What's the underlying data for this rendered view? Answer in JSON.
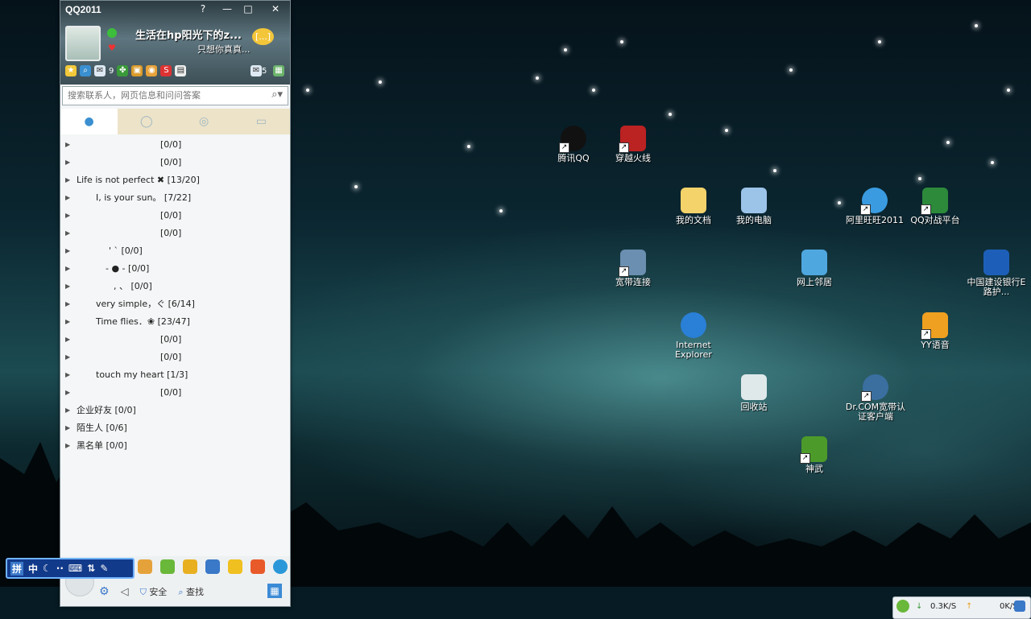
{
  "qq_window": {
    "title": "QQ2011",
    "nickname": "生活在hp阳光下的z...",
    "signature": "只想你真真...",
    "weather_badge": "[...]",
    "mail_count": "9",
    "msg_count": "5",
    "search_placeholder": "搜索联系人，网页信息和问问答案",
    "tabs": [
      "contacts-tab",
      "groups-tab",
      "discussion-tab",
      "recent-tab"
    ],
    "groups": [
      {
        "label": "[0/0]"
      },
      {
        "label": "[0/0]"
      },
      {
        "label": "Life is not perfect  ✖   [13/20]"
      },
      {
        "label": "I, is your sun。   [7/22]"
      },
      {
        "label": "[0/0]"
      },
      {
        "label": "[0/0]"
      },
      {
        "label": "'       `          [0/0]"
      },
      {
        "label": "-   ●   -        [0/0]"
      },
      {
        "label": ",       、        [0/0]"
      },
      {
        "label": "very simple，ぐ   [6/14]"
      },
      {
        "label": "Time flies．❀    [23/47]"
      },
      {
        "label": "[0/0]"
      },
      {
        "label": "[0/0]"
      },
      {
        "label": "touch my heart   [1/3]"
      },
      {
        "label": "[0/0]"
      },
      {
        "label": "企业好友   [0/0]"
      },
      {
        "label": "陌生人   [0/6]"
      },
      {
        "label": "黑名单   [0/0]"
      }
    ],
    "bottom": {
      "security_label": "安全",
      "find_label": "查找"
    }
  },
  "ime": {
    "mode": "中"
  },
  "desktop_icons": [
    {
      "label": "腾讯QQ"
    },
    {
      "label": "穿越火线"
    },
    {
      "label": "我的文档"
    },
    {
      "label": "我的电脑"
    },
    {
      "label": "阿里旺旺2011"
    },
    {
      "label": "QQ对战平台"
    },
    {
      "label": "宽带连接"
    },
    {
      "label": "网上邻居"
    },
    {
      "label": "中国建设银行E路护..."
    },
    {
      "label": "Internet Explorer"
    },
    {
      "label": "YY语音"
    },
    {
      "label": "回收站"
    },
    {
      "label": "Dr.COM宽带认证客户端"
    },
    {
      "label": "神武"
    }
  ],
  "tray": {
    "download_speed": "0.3K/S",
    "upload_speed": "0K/S"
  },
  "colors": {
    "qq_accent": "#3a8fd1",
    "tab_bar": "#ece3c8",
    "ime_bg": "#123a8a"
  }
}
